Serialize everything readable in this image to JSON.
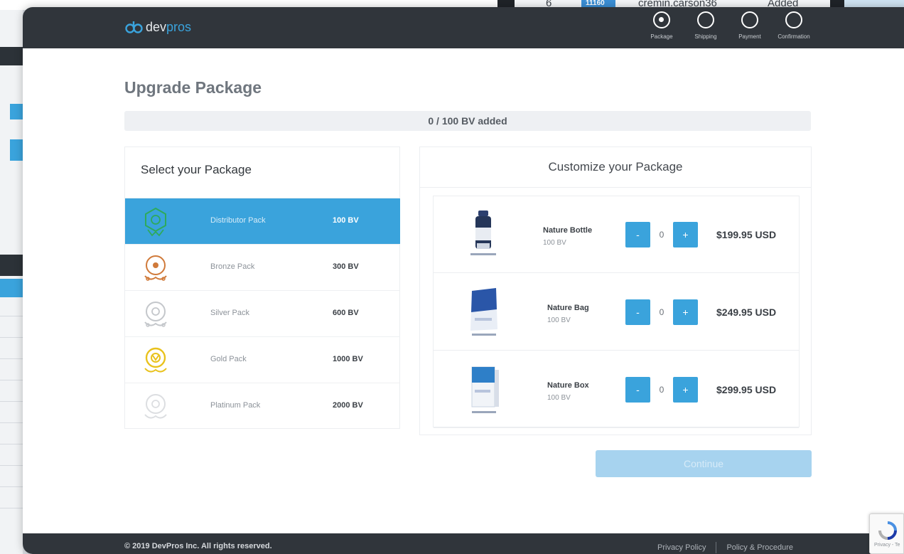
{
  "background": {
    "top_fragments": [
      "6",
      "11160",
      "cremin.carson36",
      "Added"
    ]
  },
  "header": {
    "logo_text_a": "dev",
    "logo_text_b": "pros",
    "steps": [
      {
        "label": "Package",
        "active": true
      },
      {
        "label": "Shipping",
        "active": false
      },
      {
        "label": "Payment",
        "active": false
      },
      {
        "label": "Confirmation",
        "active": false
      }
    ]
  },
  "page": {
    "title": "Upgrade Package",
    "progress_text": "0 / 100 BV added",
    "progress_fraction": 0
  },
  "packages": {
    "title": "Select your Package",
    "items": [
      {
        "name": "Distributor Pack",
        "bv": "100 BV",
        "selected": true,
        "medal_color": "#2eaa5c"
      },
      {
        "name": "Bronze Pack",
        "bv": "300 BV",
        "selected": false,
        "medal_color": "#d07a3a"
      },
      {
        "name": "Silver Pack",
        "bv": "600 BV",
        "selected": false,
        "medal_color": "#c4c7cb"
      },
      {
        "name": "Gold Pack",
        "bv": "1000 BV",
        "selected": false,
        "medal_color": "#e9c21c"
      },
      {
        "name": "Platinum Pack",
        "bv": "2000 BV",
        "selected": false,
        "medal_color": "#dcdee1"
      }
    ]
  },
  "customize": {
    "title": "Customize your Package",
    "products": [
      {
        "name": "Nature Bottle",
        "bv": "100 BV",
        "qty": "0",
        "price": "$199.95 USD",
        "minus": "-",
        "plus": "+"
      },
      {
        "name": "Nature Bag",
        "bv": "100 BV",
        "qty": "0",
        "price": "$249.95 USD",
        "minus": "-",
        "plus": "+"
      },
      {
        "name": "Nature Box",
        "bv": "100 BV",
        "qty": "0",
        "price": "$299.95 USD",
        "minus": "-",
        "plus": "+"
      }
    ]
  },
  "continue_label": "Continue",
  "footer": {
    "copyright": "© 2019 DevPros Inc. All rights reserved.",
    "privacy": "Privacy Policy",
    "policy": "Policy & Procedure"
  },
  "recaptcha": {
    "label": "Privacy - Te"
  },
  "colors": {
    "accent": "#3aa3dc",
    "header_bg": "#30353b",
    "continue_disabled": "#a7d3ef"
  }
}
